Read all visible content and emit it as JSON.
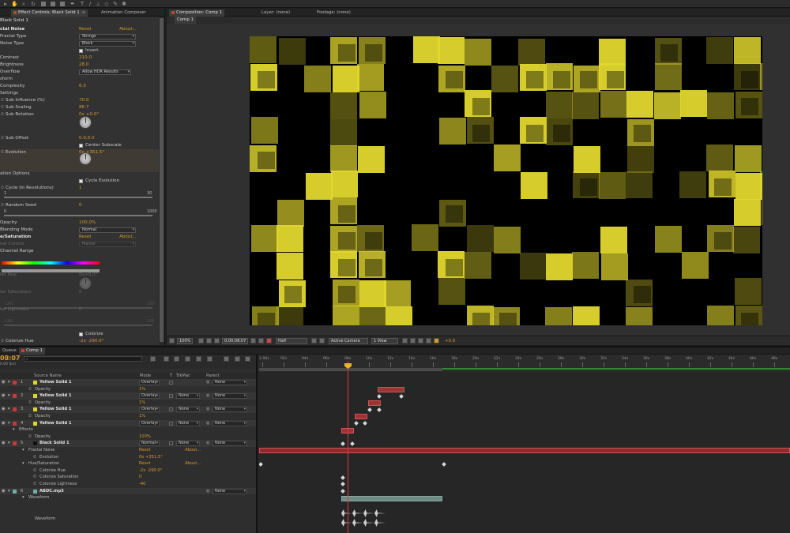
{
  "effect_panel": {
    "tab_effect_controls": "Effect Controls: Black Solid 1",
    "tab_animation_composer": "Animation Composer",
    "layer_name": "Black Solid 1",
    "rows": [
      {
        "label": "ctal Noise",
        "value": "Reset",
        "extra": "About...",
        "kind": "header"
      },
      {
        "label": "Fractal Type",
        "value": "Strings",
        "kind": "dropdown"
      },
      {
        "label": "Noise Type",
        "value": "Block",
        "kind": "dropdown"
      },
      {
        "label": "",
        "value": "Invert",
        "kind": "checkbox"
      },
      {
        "label": "Contrast",
        "value": "210.0",
        "kind": "value"
      },
      {
        "label": "Brightness",
        "value": "28.0",
        "kind": "value"
      },
      {
        "label": "Overflow",
        "value": "Allow HDR Results",
        "kind": "dropdown"
      },
      {
        "label": "sform",
        "value": "",
        "kind": "section"
      },
      {
        "label": "Complexity",
        "value": "6.0",
        "kind": "value"
      },
      {
        "label": "Settings",
        "value": "",
        "kind": "section"
      },
      {
        "label": "Sub Influence (%)",
        "value": "70.0",
        "kind": "value"
      },
      {
        "label": "Sub Scaling",
        "value": "86.7",
        "kind": "value"
      },
      {
        "label": "Sub Rotation",
        "value": "0x +0.0°",
        "kind": "value"
      },
      {
        "label": "Sub Offset",
        "value": "0.0,0.0",
        "kind": "value"
      },
      {
        "label": "",
        "value": "Center Subscale",
        "kind": "checkbox"
      },
      {
        "label": "Evolution",
        "value": "0x +351.5°",
        "kind": "value"
      },
      {
        "label": "ation Options",
        "value": "",
        "kind": "section"
      },
      {
        "label": "",
        "value": "Cycle Evolution",
        "kind": "checkbox"
      },
      {
        "label": "Cycle (in Revolutions)",
        "value": "1",
        "kind": "value"
      },
      {
        "label": "Random Seed",
        "value": "0",
        "kind": "value"
      },
      {
        "label": "Opacity",
        "value": "100.0%",
        "kind": "value"
      },
      {
        "label": "Blending Mode",
        "value": "Normal",
        "kind": "dropdown"
      },
      {
        "label": "e/Saturation",
        "value": "Reset",
        "extra": "About...",
        "kind": "header"
      },
      {
        "label": "nel Control",
        "value": "Master",
        "kind": "dropdown-dim"
      },
      {
        "label": "Channel Range",
        "value": "",
        "kind": "section"
      },
      {
        "label": "ter Hue",
        "value": "0x+0.0°",
        "kind": "dim"
      },
      {
        "label": "ter Saturation",
        "value": "0",
        "kind": "dim"
      },
      {
        "label": "ter Lightness",
        "value": "0",
        "kind": "dim"
      },
      {
        "label": "",
        "value": "Colorize",
        "kind": "checkbox"
      },
      {
        "label": "Colorize Hue",
        "value": "-2x -290.0°",
        "kind": "value"
      },
      {
        "label": "Colorize Saturation",
        "value": "0",
        "kind": "value"
      }
    ],
    "cycle_min": "1",
    "cycle_max": "30",
    "seed_min": "0",
    "seed_max": "1000",
    "sat_min": "-100",
    "sat_max": "100",
    "light_min": "-100",
    "light_max": "100"
  },
  "comp_panel": {
    "tab_composition": "Composition: Comp 1",
    "tab_layer": "Layer: (none)",
    "tab_footage": "Footage: (none)",
    "comp_tab": "Comp 1",
    "zoom": "100%",
    "timecode": "0;00;08;07",
    "resolution": "Half",
    "camera": "Active Camera",
    "views": "1 View",
    "exposure": "+0.0"
  },
  "timeline": {
    "tab_render_queue": "Queue",
    "tab_comp": "Comp 1",
    "current_time": "08:07",
    "fps": "0.00 fps)",
    "headers": {
      "source_name": "Source Name",
      "mode": "Mode",
      "t": "T",
      "trkmat": "TrkMat",
      "parent": "Parent"
    },
    "ruler": [
      "1:00s",
      "02s",
      "04s",
      "06s",
      "08s",
      "10s",
      "12s",
      "14s",
      "16s",
      "18s",
      "20s",
      "22s",
      "24s",
      "26s",
      "28s",
      "30s",
      "32s",
      "34s",
      "36s",
      "38s",
      "40s",
      "42s",
      "44s",
      "46s",
      "48s"
    ],
    "rows": [
      {
        "num": "1",
        "name": "Yellow Solid 1",
        "mode": "Overlay",
        "trk": "",
        "parent": "None",
        "type": "layer",
        "color": "#e0d52a"
      },
      {
        "name": "Opacity",
        "value": "1%",
        "type": "prop"
      },
      {
        "num": "2",
        "name": "Yellow Solid 1",
        "mode": "Overlay",
        "trk": "None",
        "parent": "None",
        "type": "layer",
        "color": "#e0d52a"
      },
      {
        "name": "Opacity",
        "value": "1%",
        "type": "prop"
      },
      {
        "num": "3",
        "name": "Yellow Solid 1",
        "mode": "Overlay",
        "trk": "None",
        "parent": "None",
        "type": "layer",
        "color": "#e0d52a"
      },
      {
        "name": "Opacity",
        "value": "1%",
        "type": "prop"
      },
      {
        "num": "4",
        "name": "Yellow Solid 1",
        "mode": "Overlay",
        "trk": "None",
        "parent": "None",
        "type": "layer",
        "color": "#e0d52a"
      },
      {
        "name": "Effects",
        "value": "",
        "type": "group"
      },
      {
        "name": "Opacity",
        "value": "100%",
        "type": "prop"
      },
      {
        "num": "5",
        "name": "Black Solid 1",
        "mode": "Normal",
        "trk": "None",
        "parent": "None",
        "type": "layer",
        "color": "#111111"
      },
      {
        "name": "Fractal Noise",
        "value": "Reset",
        "extra": "About...",
        "type": "group"
      },
      {
        "name": "Evolution",
        "value": "0x +351.5°",
        "type": "prop"
      },
      {
        "name": "Hue/Saturation",
        "value": "Reset",
        "extra": "About...",
        "type": "group"
      },
      {
        "name": "Colorize Hue",
        "value": "-2x -290.0°",
        "type": "prop"
      },
      {
        "name": "Colorize Saturation",
        "value": "0",
        "type": "prop"
      },
      {
        "name": "Colorize Lightness",
        "value": "-40",
        "type": "prop"
      },
      {
        "num": "6",
        "name": "ABDC.mp3",
        "mode": "",
        "trk": "",
        "parent": "None",
        "type": "layer",
        "color": "#6bb3a0"
      },
      {
        "name": "Waveform",
        "value": "",
        "type": "group"
      },
      {
        "name": "Waveform",
        "value": "",
        "type": "wave"
      }
    ]
  }
}
